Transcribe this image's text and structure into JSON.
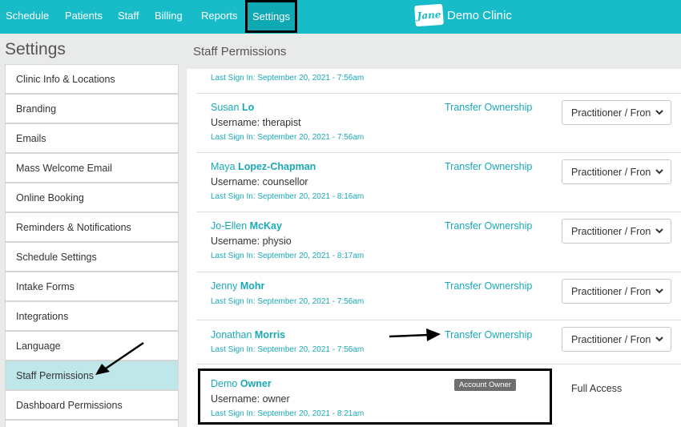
{
  "nav": {
    "items": [
      "Schedule",
      "Patients",
      "Staff",
      "Billing",
      "Reports"
    ],
    "active": "Settings"
  },
  "brand": {
    "logo_text": "Jane",
    "clinic": "Demo Clinic"
  },
  "sidebar": {
    "title": "Settings",
    "items": [
      "Clinic Info & Locations",
      "Branding",
      "Emails",
      "Mass Welcome Email",
      "Online Booking",
      "Reminders & Notifications",
      "Schedule Settings",
      "Intake Forms",
      "Integrations",
      "Language",
      "Staff Permissions",
      "Dashboard Permissions"
    ],
    "active_index": 10
  },
  "main": {
    "title": "Staff Permissions",
    "partial_signin": "Last Sign In: September 20, 2021 - 7:56am",
    "staff": [
      {
        "first": "Susan",
        "last": "Lo",
        "username": "Username: therapist",
        "signin": "Last Sign In: September 20, 2021 - 7:56am",
        "transfer": "Transfer Ownership",
        "role": "Practitioner / Fron"
      },
      {
        "first": "Maya",
        "last": "Lopez-Chapman",
        "username": "Username: counsellor",
        "signin": "Last Sign In: September 20, 2021 - 8:16am",
        "transfer": "Transfer Ownership",
        "role": "Practitioner / Fron"
      },
      {
        "first": "Jo-Ellen",
        "last": "McKay",
        "username": "Username: physio",
        "signin": "Last Sign In: September 20, 2021 - 8:17am",
        "transfer": "Transfer Ownership",
        "role": "Practitioner / Fron"
      },
      {
        "first": "Jenny",
        "last": "Mohr",
        "username": "",
        "signin": "Last Sign In: September 20, 2021 - 7:56am",
        "transfer": "Transfer Ownership",
        "role": "Practitioner / Fron"
      },
      {
        "first": "Jonathan",
        "last": "Morris",
        "username": "",
        "signin": "Last Sign In: September 20, 2021 - 7:56am",
        "transfer": "Transfer Ownership",
        "role": "Practitioner / Fron"
      }
    ],
    "owner": {
      "first": "Demo",
      "last": "Owner",
      "username": "Username: owner",
      "signin": "Last Sign In: September 20, 2021 - 8:21am",
      "badge": "Account Owner",
      "access": "Full Access"
    }
  },
  "colors": {
    "accent": "#17bcc8",
    "link": "#19a9b6",
    "active_item": "#bfe7ea"
  }
}
